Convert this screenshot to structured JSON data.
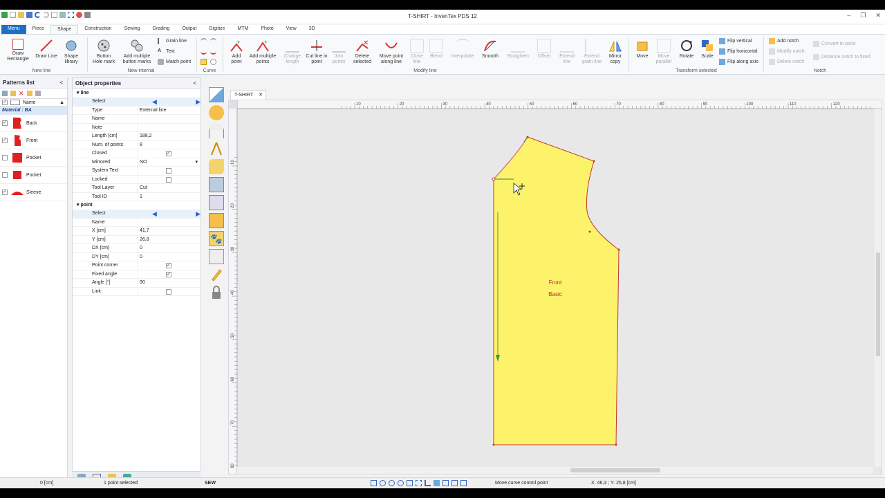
{
  "app": {
    "title": "T-SHIRT - InvenTex PDS 12"
  },
  "tabs": [
    {
      "label": "Menu"
    },
    {
      "label": "Piece"
    },
    {
      "label": "Shape"
    },
    {
      "label": "Construction"
    },
    {
      "label": "Sewing"
    },
    {
      "label": "Grading"
    },
    {
      "label": "Output"
    },
    {
      "label": "Digitize"
    },
    {
      "label": "MTM"
    },
    {
      "label": "Photo"
    },
    {
      "label": "View"
    },
    {
      "label": "3D"
    }
  ],
  "ribbon": {
    "draw_rectangle": "Draw Rectangle",
    "draw_line": "Draw Line",
    "shape_library": "Shape library",
    "new_line_group": "New line",
    "button_hole_mark": "Button Hole mark",
    "add_multiple_button_marks": "Add multiple button marks",
    "grain_line": "Grain line",
    "text": "Text",
    "match_point": "Match point",
    "new_internal_group": "New internal",
    "curve_group": "Curve",
    "add_point": "Add point",
    "add_multiple_points": "Add multiple points",
    "change_length": "Change length",
    "cut_line_in_point": "Cut line in point",
    "join_points": "Join points",
    "delete_selected": "Delete selected",
    "move_point_along_line": "Move point along line",
    "close_line": "Close line",
    "blend": "Blend",
    "interpolate": "Interpolate",
    "smooth": "Smooth",
    "straighten": "Straighten",
    "offset": "Offset",
    "extend_line": "Extend line",
    "extend_grain_line": "Extend grain line",
    "mirror_copy": "Mirror copy",
    "modify_line_group": "Modify line",
    "move": "Move",
    "move_parallel": "Move parallel",
    "rotate": "Rotate",
    "scale": "Scale",
    "flip_vertical": "Flip vertical",
    "flip_horizontal": "Flip horizontal",
    "flip_along_axis": "Flip along axis",
    "transform_group": "Transform selected",
    "add_notch": "Add notch",
    "modify_notch": "Modify notch",
    "delete_notch": "Delete notch",
    "convert_to_point": "Convert to point",
    "distance_notch_to_fixed": "Distance notch to fixed",
    "notch_group": "Notch"
  },
  "patterns": {
    "title": "Patterns list",
    "collapse": "<",
    "column_name": "Name",
    "material": "Material : BA",
    "items": [
      {
        "name": "Back",
        "checked": true
      },
      {
        "name": "Front",
        "checked": true
      },
      {
        "name": "Pocket",
        "checked": false
      },
      {
        "name": "Pocket",
        "checked": false
      },
      {
        "name": "Sleeve",
        "checked": true
      }
    ]
  },
  "props": {
    "title": "Object properties",
    "collapse": "<",
    "line_section": "line",
    "point_section": "point",
    "line": [
      {
        "k": "Select",
        "v": ""
      },
      {
        "k": "Type",
        "v": "External line"
      },
      {
        "k": "Name",
        "v": ""
      },
      {
        "k": "Note",
        "v": ""
      },
      {
        "k": "Length [cm]",
        "v": "188,2"
      },
      {
        "k": "Num. of points",
        "v": "8"
      },
      {
        "k": "Closed",
        "v": "✓"
      },
      {
        "k": "Mirrored",
        "v": "NO"
      },
      {
        "k": "System Text",
        "v": ""
      },
      {
        "k": "Locked",
        "v": ""
      },
      {
        "k": "Tool Layer",
        "v": "Cut"
      },
      {
        "k": "Tool ID",
        "v": "1"
      }
    ],
    "point": [
      {
        "k": "Select",
        "v": ""
      },
      {
        "k": "Name",
        "v": ""
      },
      {
        "k": "X [cm]",
        "v": "41,7"
      },
      {
        "k": "Y [cm]",
        "v": "26,8"
      },
      {
        "k": "DX [cm]",
        "v": "0"
      },
      {
        "k": "DY [cm]",
        "v": "0"
      },
      {
        "k": "Point corner",
        "v": "✓"
      },
      {
        "k": "Fixed angle",
        "v": "✓"
      },
      {
        "k": "Angle [°]",
        "v": "90"
      },
      {
        "k": "Link",
        "v": ""
      }
    ]
  },
  "document_tab": "T-SHIRT",
  "ruler": {
    "h_labels": [
      "10",
      "20",
      "30",
      "40",
      "50",
      "60",
      "70",
      "80",
      "90",
      "100",
      "110",
      "120"
    ],
    "v_labels": [
      "10",
      "20",
      "30",
      "40",
      "50",
      "60",
      "70",
      "80"
    ]
  },
  "piece": {
    "name": "Front",
    "size": "Basic",
    "fill": "#fdf36b"
  },
  "status": {
    "units": "0 [cm]",
    "selection": "1 point selected",
    "mode": "SEW",
    "hint": "Move curve control point",
    "coords": "X: 46,3 ; Y: 25,8 [cm]"
  },
  "colors": {
    "accent": "#1e6fc4",
    "piece_fill": "#fdf36b",
    "piece_outline": "#c0392b"
  }
}
